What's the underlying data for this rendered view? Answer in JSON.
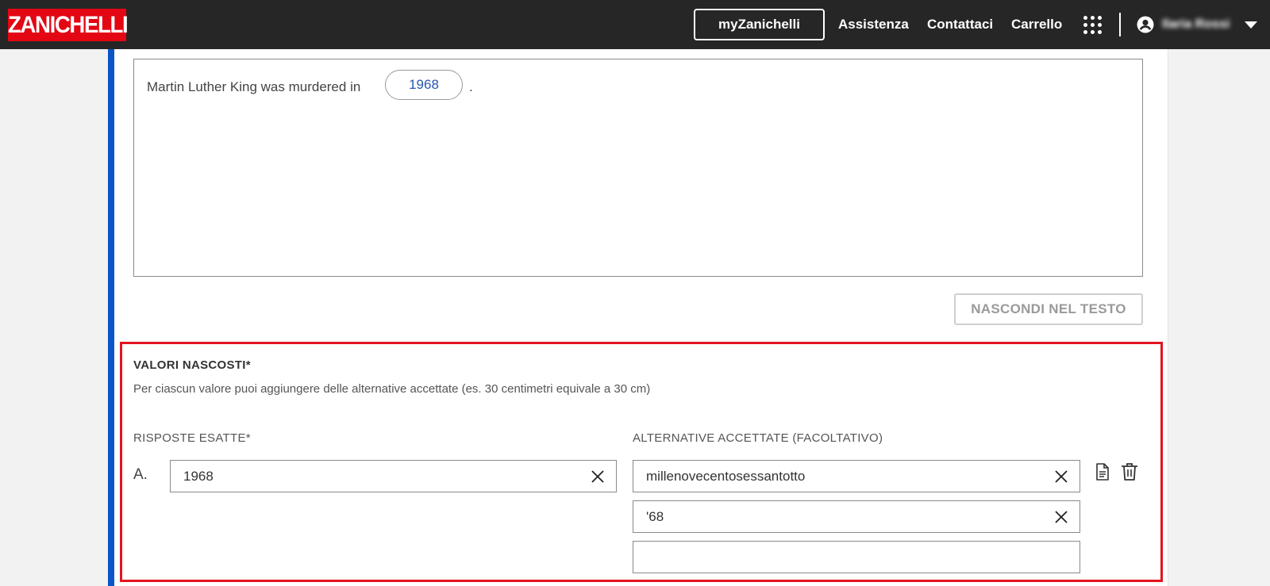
{
  "header": {
    "logo": "ZANICHELLI",
    "my_button": "myZanichelli",
    "links": [
      "Assistenza",
      "Contattaci",
      "Carrello"
    ],
    "user_name": "Ilaria Rossi",
    "icons": [
      "apps-grid-icon",
      "user-icon",
      "caret-down-icon"
    ]
  },
  "editor": {
    "sentence": "Martin Luther King was murdered in",
    "hidden_value": "1968",
    "period": "."
  },
  "hide_button": "NASCONDI NEL TESTO",
  "hidden_values": {
    "title": "VALORI NASCOSTI*",
    "description": "Per ciascun valore puoi aggiungere delle alternative accettate (es. 30 centimetri equivale a 30 cm)",
    "col_correct": "RISPOSTE ESATTE*",
    "col_alternatives": "ALTERNATIVE ACCETTATE (FACOLTATIVO)",
    "rows": [
      {
        "letter": "A.",
        "answer": "1968",
        "alternatives": [
          "millenovecentosessantotto",
          "'68",
          ""
        ]
      }
    ]
  },
  "colors": {
    "topbar": "#262626",
    "brand_red": "#e30613",
    "accent_blue": "#0a55c7",
    "highlight_red": "#e3141f",
    "pill_text": "#2857b0"
  }
}
